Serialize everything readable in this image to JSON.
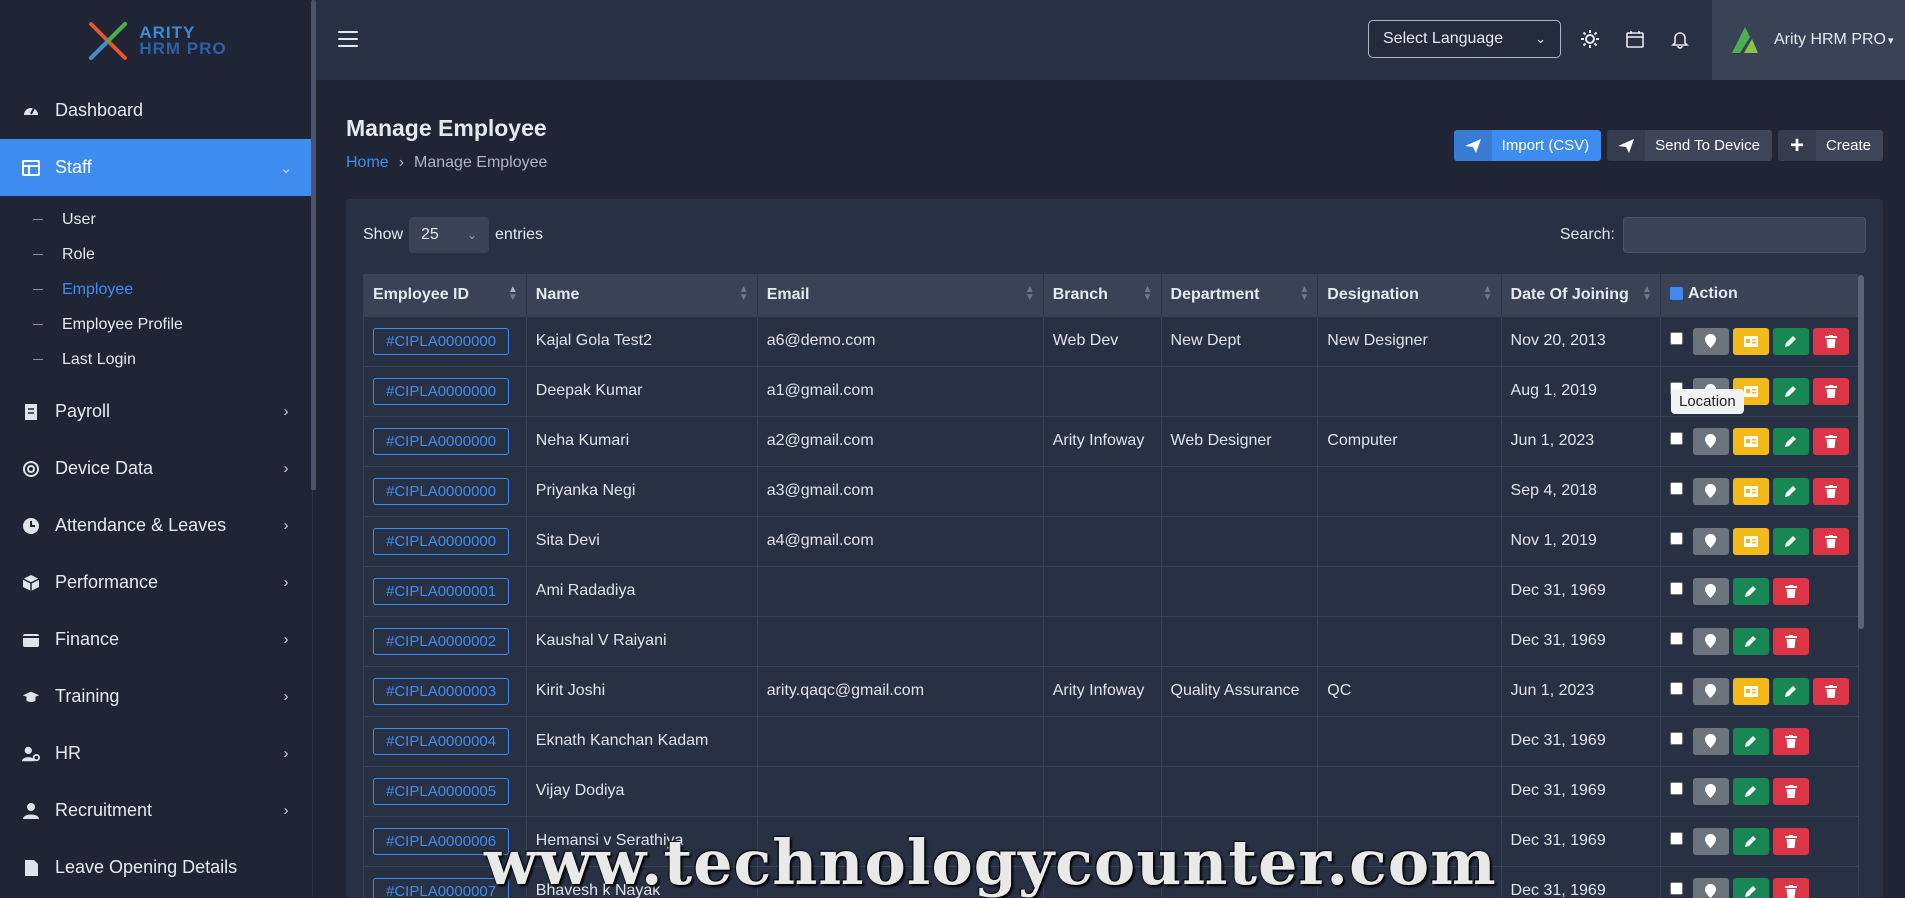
{
  "sidebar": {
    "logo": {
      "line1": "ARITY",
      "line2": "HRM PRO"
    },
    "items": [
      {
        "label": "Dashboard"
      },
      {
        "label": "Staff"
      },
      {
        "label": "Payroll"
      },
      {
        "label": "Device Data"
      },
      {
        "label": "Attendance & Leaves"
      },
      {
        "label": "Performance"
      },
      {
        "label": "Finance"
      },
      {
        "label": "Training"
      },
      {
        "label": "HR"
      },
      {
        "label": "Recruitment"
      },
      {
        "label": "Leave Opening Details"
      }
    ],
    "staff_sub": [
      {
        "label": "User"
      },
      {
        "label": "Role"
      },
      {
        "label": "Employee"
      },
      {
        "label": "Employee Profile"
      },
      {
        "label": "Last Login"
      }
    ]
  },
  "topbar": {
    "language": "Select Language",
    "profile_name": "Arity HRM PRO"
  },
  "page": {
    "title": "Manage Employee",
    "breadcrumb_home": "Home",
    "breadcrumb_current": "Manage Employee",
    "btn_import": "Import (CSV)",
    "btn_send": "Send To Device",
    "btn_create": "Create"
  },
  "table_controls": {
    "show_label": "Show",
    "entries_value": "25",
    "entries_label": "entries",
    "search_label": "Search:"
  },
  "table": {
    "headers": [
      "Employee ID",
      "Name",
      "Email",
      "Branch",
      "Department",
      "Designation",
      "Date Of Joining",
      "Action"
    ],
    "rows": [
      {
        "id": "#CIPLA0000000",
        "name": "Kajal Gola Test2",
        "email": "a6@demo.com",
        "branch": "Web Dev",
        "department": "New Dept",
        "designation": "New Designer",
        "doj": "Nov 20, 2013",
        "card": true
      },
      {
        "id": "#CIPLA0000000",
        "name": "Deepak Kumar",
        "email": "a1@gmail.com",
        "branch": "",
        "department": "",
        "designation": "",
        "doj": "Aug 1, 2019",
        "card": true
      },
      {
        "id": "#CIPLA0000000",
        "name": "Neha Kumari",
        "email": "a2@gmail.com",
        "branch": "Arity Infoway",
        "department": "Web Designer",
        "designation": "Computer",
        "doj": "Jun 1, 2023",
        "card": true
      },
      {
        "id": "#CIPLA0000000",
        "name": "Priyanka Negi",
        "email": "a3@gmail.com",
        "branch": "",
        "department": "",
        "designation": "",
        "doj": "Sep 4, 2018",
        "card": true
      },
      {
        "id": "#CIPLA0000000",
        "name": "Sita Devi",
        "email": "a4@gmail.com",
        "branch": "",
        "department": "",
        "designation": "",
        "doj": "Nov 1, 2019",
        "card": true
      },
      {
        "id": "#CIPLA0000001",
        "name": "Ami Radadiya",
        "email": "",
        "branch": "",
        "department": "",
        "designation": "",
        "doj": "Dec 31, 1969",
        "card": false
      },
      {
        "id": "#CIPLA0000002",
        "name": "Kaushal V Raiyani",
        "email": "",
        "branch": "",
        "department": "",
        "designation": "",
        "doj": "Dec 31, 1969",
        "card": false
      },
      {
        "id": "#CIPLA0000003",
        "name": "Kirit Joshi",
        "email": "arity.qaqc@gmail.com",
        "branch": "Arity Infoway",
        "department": "Quality Assurance",
        "designation": "QC",
        "doj": "Jun 1, 2023",
        "card": true
      },
      {
        "id": "#CIPLA0000004",
        "name": "Eknath Kanchan Kadam",
        "email": "",
        "branch": "",
        "department": "",
        "designation": "",
        "doj": "Dec 31, 1969",
        "card": false
      },
      {
        "id": "#CIPLA0000005",
        "name": "Vijay Dodiya",
        "email": "",
        "branch": "",
        "department": "",
        "designation": "",
        "doj": "Dec 31, 1969",
        "card": false
      },
      {
        "id": "#CIPLA0000006",
        "name": "Hemansi v Serathiya",
        "email": "",
        "branch": "",
        "department": "",
        "designation": "",
        "doj": "Dec 31, 1969",
        "card": false
      },
      {
        "id": "#CIPLA0000007",
        "name": "Bhavesh k Nayak",
        "email": "",
        "branch": "",
        "department": "",
        "designation": "",
        "doj": "Dec 31, 1969",
        "card": false
      }
    ]
  },
  "tooltip": "Location",
  "watermark": "www.technologycounter.com",
  "colors": {
    "accent": "#3f8cf0",
    "location": "#6c757d",
    "card": "#f3b919",
    "edit": "#198754",
    "delete": "#dc3545"
  }
}
